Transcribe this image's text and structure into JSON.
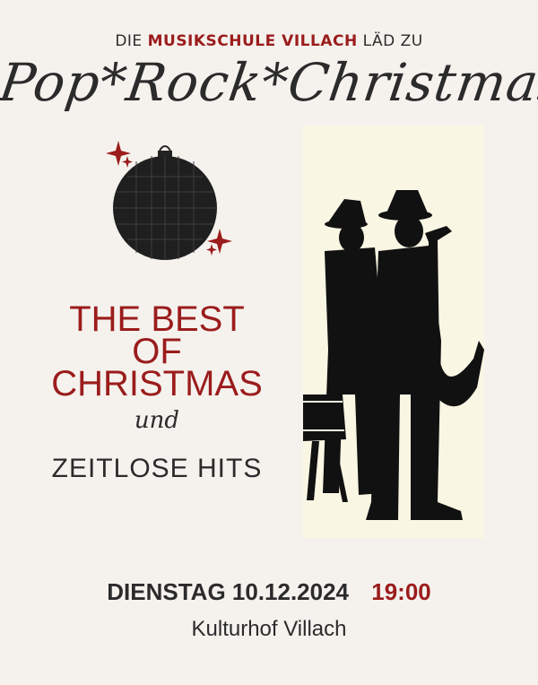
{
  "intro": {
    "prefix": "DIE",
    "school": "MUSIKSCHULE VILLACH",
    "suffix": "LÄD ZU"
  },
  "title": "Pop*Rock*Christmas",
  "headline": {
    "line1": "THE BEST",
    "line2": "OF",
    "line3": "CHRISTMAS"
  },
  "connector": "und",
  "subheadline": "ZEITLOSE HITS",
  "event": {
    "date": "DIENSTAG 10.12.2024",
    "time": "19:00",
    "venue": "Kulturhof Villach"
  },
  "icons": {
    "ornament": "christmas-bauble-icon",
    "sparkles": "sparkle-icon",
    "illustration": "jazz-musicians-silhouette"
  },
  "colors": {
    "background": "#f5f2ee",
    "accent": "#9b1c1c",
    "text": "#2b2b2b",
    "panel": "#faf6e4"
  }
}
